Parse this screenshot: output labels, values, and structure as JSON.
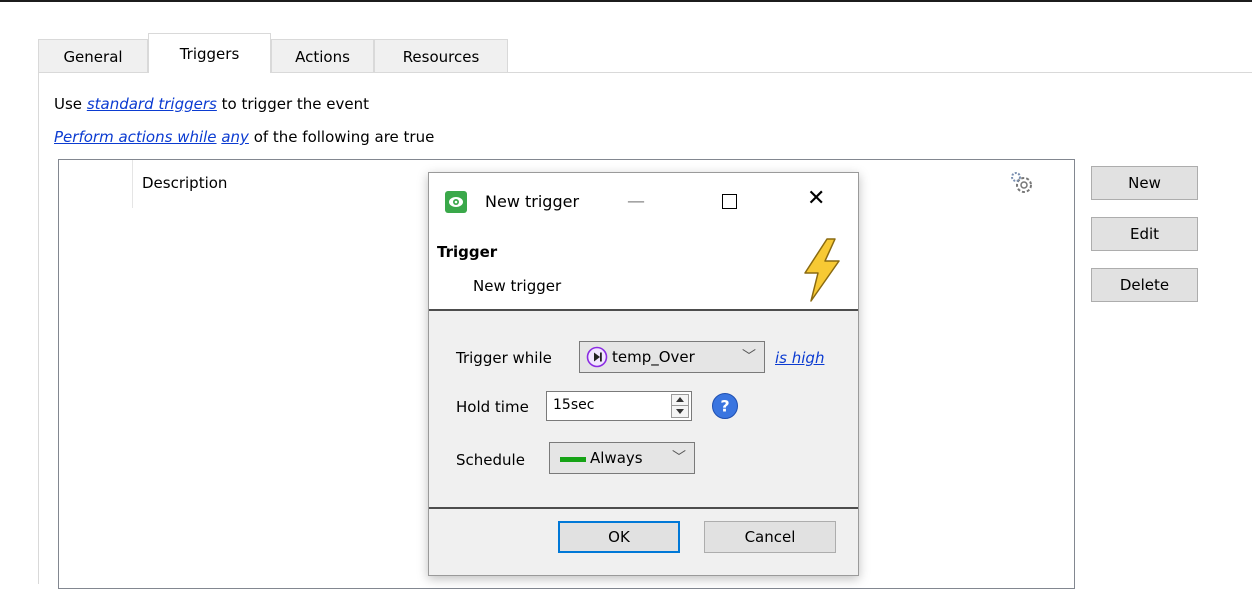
{
  "tabs": [
    {
      "label": "General"
    },
    {
      "label": "Triggers"
    },
    {
      "label": "Actions"
    },
    {
      "label": "Resources"
    }
  ],
  "triggers_panel": {
    "line1_prefix": "Use",
    "line1_link": "standard triggers",
    "line1_suffix": "to trigger the event",
    "line2_link1": "Perform actions while",
    "line2_link2": "any",
    "line2_suffix": "of the following are true",
    "column_header": "Description",
    "buttons": {
      "new": "New",
      "edit": "Edit",
      "delete": "Delete"
    }
  },
  "dialog": {
    "title": "New trigger",
    "header_title": "Trigger",
    "header_subtitle": "New trigger",
    "trigger_while_label": "Trigger while",
    "trigger_source_value": "temp_Over",
    "trigger_condition_link": "is high",
    "hold_time_label": "Hold time",
    "hold_time_value": "15sec",
    "schedule_label": "Schedule",
    "schedule_value": "Always",
    "ok_label": "OK",
    "cancel_label": "Cancel"
  },
  "colors": {
    "link": "#0b3bd1",
    "accent": "#0078d7",
    "schedule_green": "#16a316",
    "app_icon_green": "#3aa84a",
    "trigger_icon_purple": "#8a2be2"
  }
}
